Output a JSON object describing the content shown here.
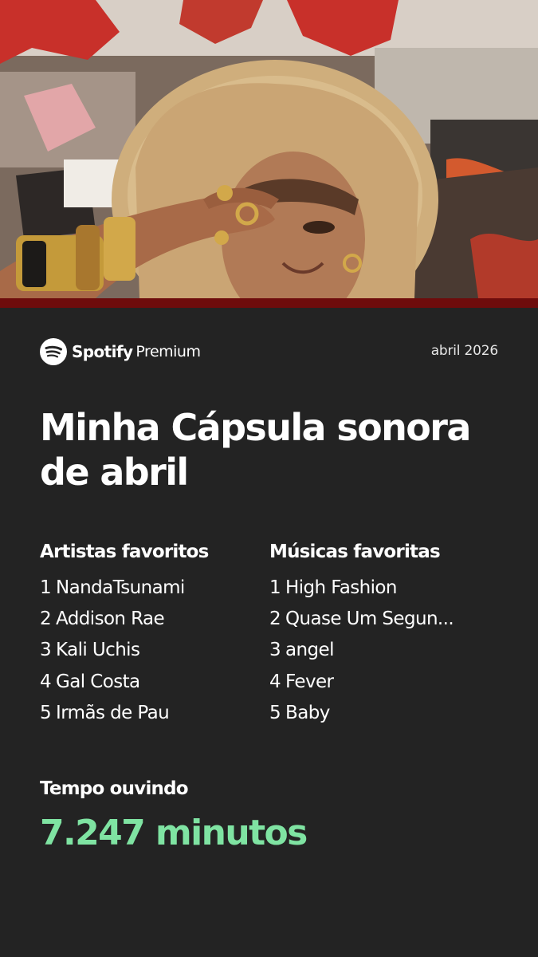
{
  "colors": {
    "background": "#232323",
    "accent_bar": "#6e0c0c",
    "minutes_green": "#7fe3a2",
    "text": "#ffffff"
  },
  "brand": {
    "icon": "spotify-logo-icon",
    "name": "Spotify",
    "tier": "Premium"
  },
  "date": "abril 2026",
  "title": "Minha Cápsula sonora de abril",
  "artists": {
    "heading": "Artistas favoritos",
    "items": [
      {
        "rank": "1",
        "name": "NandaTsunami"
      },
      {
        "rank": "2",
        "name": "Addison Rae"
      },
      {
        "rank": "3",
        "name": "Kali Uchis"
      },
      {
        "rank": "4",
        "name": "Gal Costa"
      },
      {
        "rank": "5",
        "name": "Irmãs de Pau"
      }
    ]
  },
  "songs": {
    "heading": "Músicas favoritas",
    "items": [
      {
        "rank": "1",
        "name": "High Fashion"
      },
      {
        "rank": "2",
        "name": "Quase Um Segun..."
      },
      {
        "rank": "3",
        "name": "angel"
      },
      {
        "rank": "4",
        "name": "Fever"
      },
      {
        "rank": "5",
        "name": "Baby"
      }
    ]
  },
  "listening": {
    "label": "Tempo ouvindo",
    "value": "7.247 minutos"
  }
}
